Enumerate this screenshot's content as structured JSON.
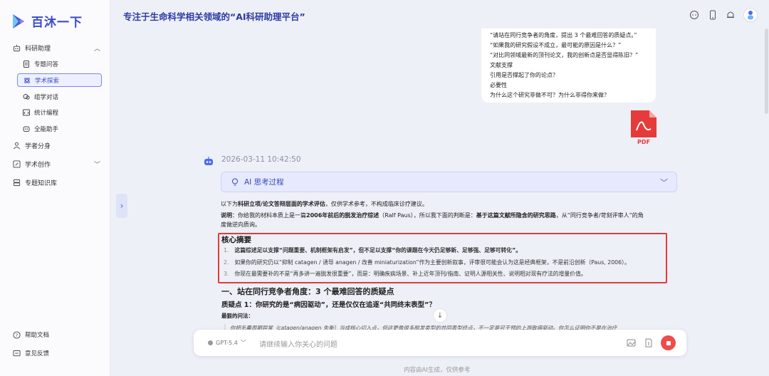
{
  "app": {
    "brand": "百沐一下",
    "page_title": "专注于生命科学相关领域的“AI科研助理平台”"
  },
  "sidebar": {
    "group_research": "科研助理",
    "items": [
      {
        "label": "专题问答"
      },
      {
        "label": "学术探索"
      },
      {
        "label": "组学对话"
      },
      {
        "label": "统计编程"
      },
      {
        "label": "全能助手"
      }
    ],
    "scholar": "学者分身",
    "academic_creation": "学术创作",
    "kb": "专题知识库",
    "help": "帮助文档",
    "feedback": "意见反馈"
  },
  "chat": {
    "user_message_lines": [
      "“请站在同行竞争者的角度，提出 3 个最难回答的质疑点。”",
      "“如果我的研究假设不成立，最可能的原因是什么？”",
      "“对比同领域最新的顶刊论文，我的创新点是否显得陈旧？”",
      "文献支撑",
      "引用是否撑起了你的论点？",
      "必要性",
      "为什么这个研究非做不可？为什么非得你来做？"
    ],
    "attachment_type": "PDF",
    "timestamp": "2026-03-11 10:42:50",
    "thinking_label": "AI 思考过程",
    "intro_prefix": "以下为",
    "intro_bold": "科研立项/论文答辩层面的学术评估",
    "intro_suffix": "，仅供学术参考，不构成临床诊疗建议。",
    "note_label": "说明",
    "note_p1": "：你给我的材料本质上是一篇",
    "note_b1": "2006年前后的脱发治疗综述",
    "note_p2": "（Ralf Paus），所以我下面的判断是：",
    "note_b2": "基于这篇文献所隐含的研究思路",
    "note_p3": "，从“同行竞争者/苛刻评审人”的角",
    "note_line2": "度做逆向质询。",
    "summary_title": "核心摘要",
    "summary_items": [
      {
        "num": "1.",
        "text": "这篇综述足以支撑“问题重要、机制框架有启发”，但不足以支撑“你的课题在今天仍足够新、足够强、足够可转化”。"
      },
      {
        "num": "2.",
        "text": "如果你的研究仍以“抑制 catagen / 诱导 anagen / 改善 miniaturization”作为主要创新叙事，评审很可能会认为这是经典框架，不是前沿创新（Paus, 2006）。"
      },
      {
        "num": "3.",
        "text": "你现在最需要补的不是“再多讲一遍脱发很重要”，而是：明确疾病场景、补上近年顶刊/指南、证明人源相关性、说明相对现有疗法的增量价值。"
      }
    ],
    "section1_title": "一、站在同行竞争者角度：3 个最难回答的质疑点",
    "q1_title": "质疑点 1：你研究的是“病因驱动”，还是仅仅在追逐“共同终末表型”？",
    "q1_label": "最狠的问法：",
    "q1_quote": "你把毛囊周期异常（catagen/anagen 失衡）当成核心切入点，但这更像很多脱发类型的共同表型终点，不一定是可干预的上游致病驱动。你怎么证明你不是在治疗"
  },
  "input": {
    "model": "GPT-5.4",
    "placeholder": "请继续输入你关心的问题"
  },
  "footer": {
    "disclaimer": "内容由AI生成，仅供参考"
  },
  "colors": {
    "brand": "#3a4cc7",
    "accent": "#5564d0",
    "highlight_border": "#e23a3a",
    "stop_button": "#ee4b4b"
  }
}
